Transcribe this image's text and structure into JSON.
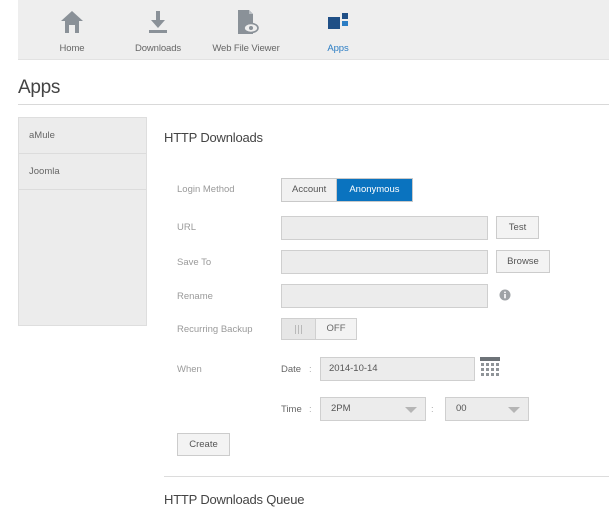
{
  "nav": {
    "items": [
      {
        "label": "Home",
        "icon": "home-icon"
      },
      {
        "label": "Downloads",
        "icon": "download-icon"
      },
      {
        "label": "Web File Viewer",
        "icon": "file-viewer-icon"
      },
      {
        "label": "Apps",
        "icon": "apps-icon",
        "active": true
      }
    ],
    "active_color": "#2b7dc4"
  },
  "page": {
    "title": "Apps"
  },
  "sidebar": {
    "items": [
      {
        "label": "aMule"
      },
      {
        "label": "Joomla"
      }
    ]
  },
  "form": {
    "section_title": "HTTP Downloads",
    "login": {
      "label": "Login Method",
      "options": [
        "Account",
        "Anonymous"
      ],
      "selected": "Anonymous"
    },
    "url": {
      "label": "URL",
      "value": "",
      "button": "Test"
    },
    "save_to": {
      "label": "Save To",
      "value": "",
      "button": "Browse"
    },
    "rename": {
      "label": "Rename",
      "value": "",
      "icon": "info-icon"
    },
    "recurring": {
      "label": "Recurring Backup",
      "state": "OFF"
    },
    "when": {
      "label": "When",
      "date_label": "Date",
      "date_value": "2014-10-14",
      "time_label": "Time",
      "hour": "2PM",
      "minute": "00",
      "colon": ":"
    },
    "create_button": "Create"
  },
  "queue": {
    "title": "HTTP Downloads Queue"
  },
  "colors": {
    "accent": "#0a73bf",
    "nav_bg": "#eeeeee",
    "sidebar_bg": "#ececec"
  }
}
